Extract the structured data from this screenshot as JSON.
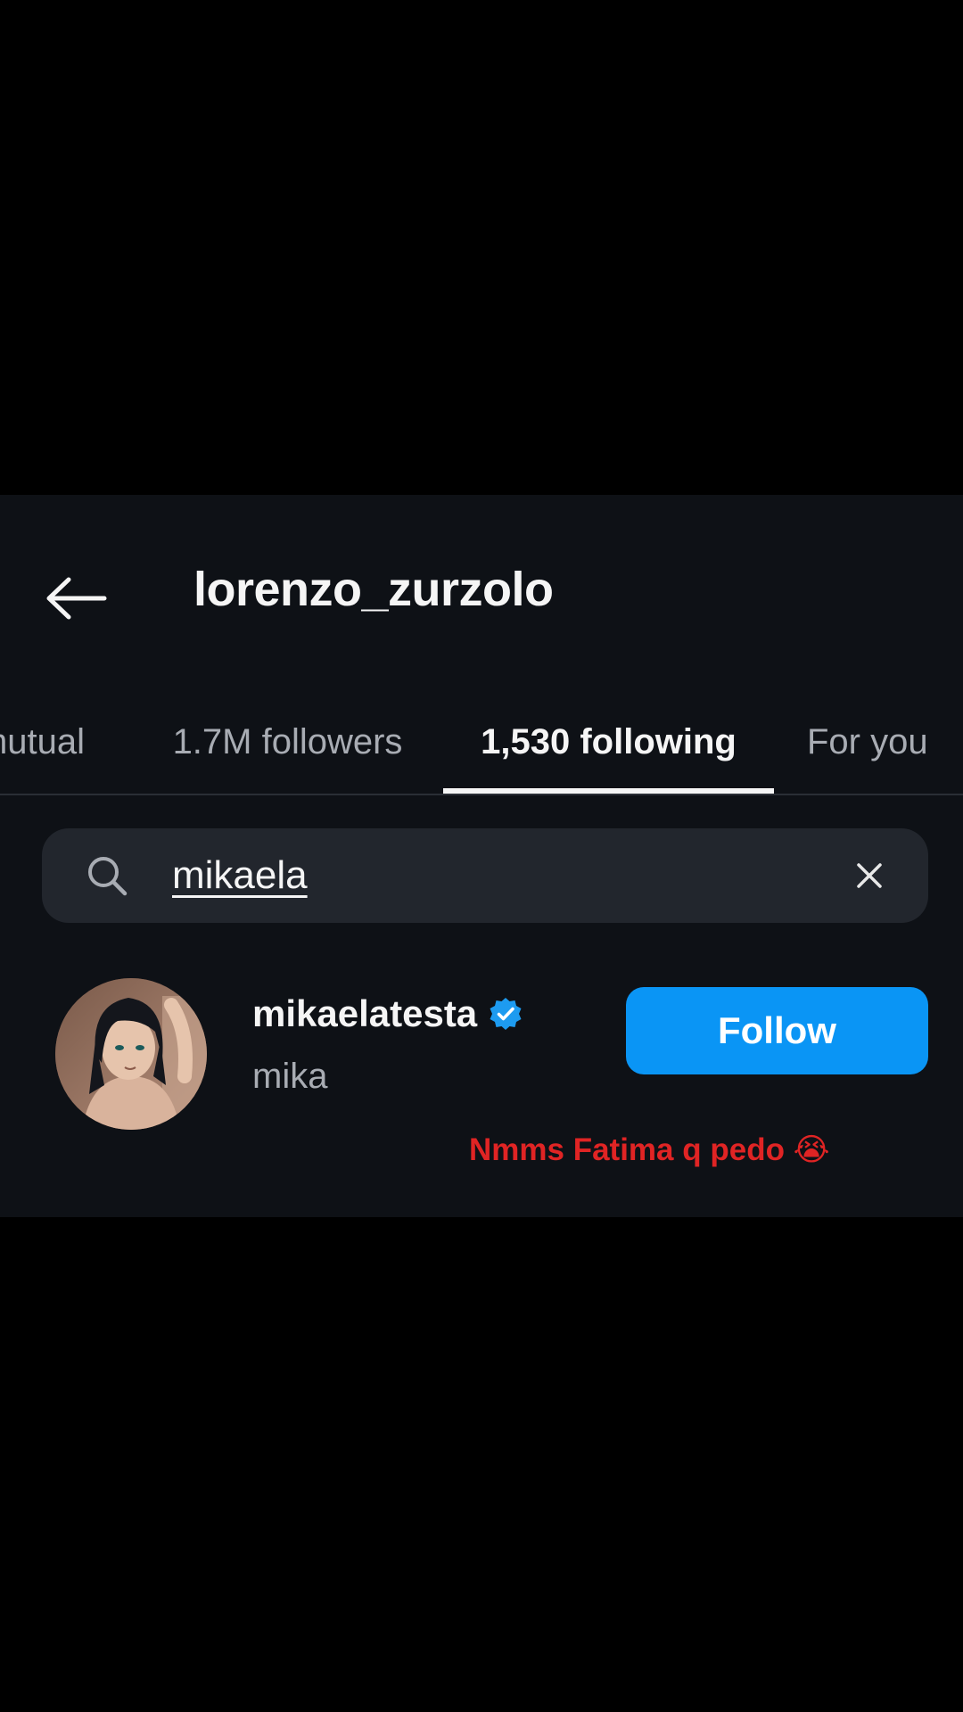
{
  "header": {
    "title": "lorenzo_zurzolo"
  },
  "tabs": [
    {
      "label": "mutual"
    },
    {
      "label": "1.7M followers"
    },
    {
      "label": "1,530 following"
    },
    {
      "label": "For you"
    }
  ],
  "active_tab": "1,530 following",
  "search": {
    "value": "mikaela"
  },
  "result": {
    "username": "mikaelatesta",
    "display_name": "mika",
    "verified": true,
    "follow_label": "Follow"
  },
  "caption": {
    "text": "Nmms Fatima q pedo 😭"
  },
  "colors": {
    "panel_bg": "#0e1116",
    "search_bg": "#22262d",
    "follow_button": "#0a95f5",
    "verified_badge": "#1d9bf0",
    "caption_text": "#e02424"
  },
  "icons": {
    "back": "arrow-left-icon",
    "search": "search-icon",
    "clear": "close-icon",
    "verified": "verified-badge-icon"
  }
}
